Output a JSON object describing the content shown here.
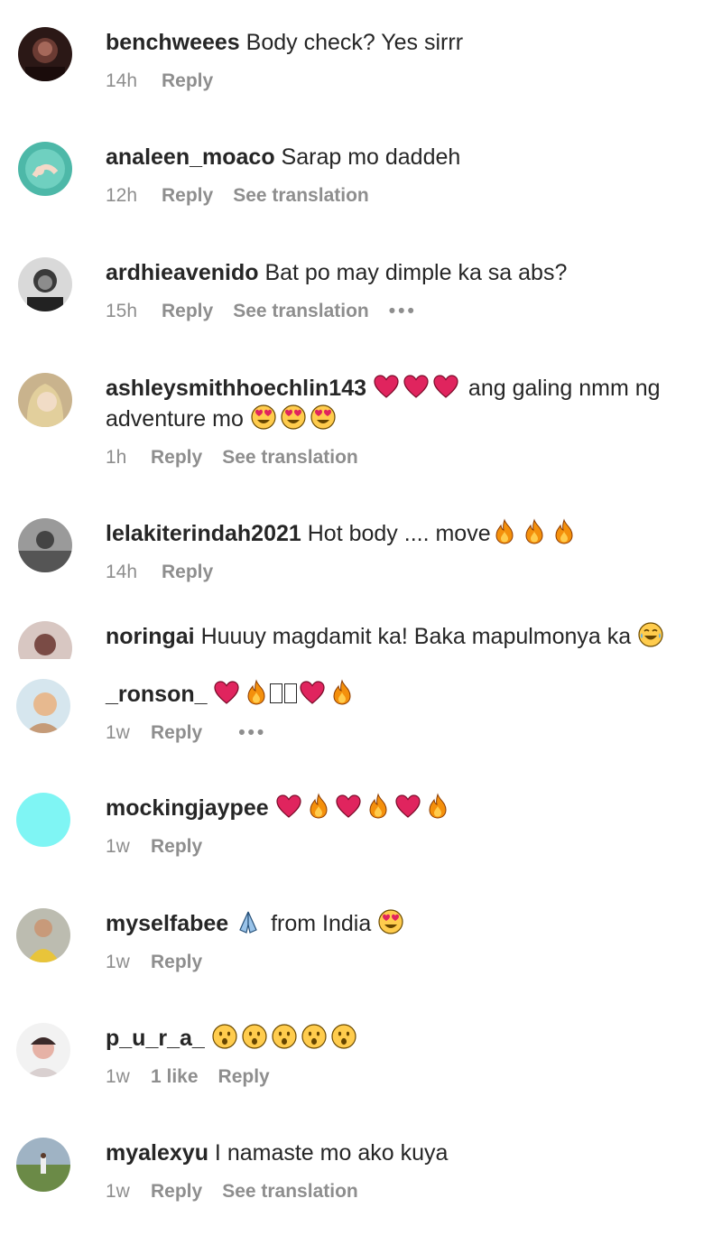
{
  "comments": [
    {
      "username": "benchweees",
      "text": "Body check? Yes sirrr",
      "time": "14h",
      "reply": "Reply"
    },
    {
      "username": "analeen_moaco",
      "text": "Sarap mo daddeh",
      "time": "12h",
      "reply": "Reply",
      "see_translation": "See translation"
    },
    {
      "username": "ardhieavenido",
      "text": "Bat po may dimple ka sa abs?",
      "time": "15h",
      "reply": "Reply",
      "see_translation": "See translation",
      "more": "•••"
    },
    {
      "username": "ashleysmithhoechlin143",
      "text": "ang galing nmm ng",
      "text2": "adventure mo",
      "time": "1h",
      "reply": "Reply",
      "see_translation": "See translation"
    },
    {
      "username": "lelakiterindah2021",
      "text": "Hot body .... move",
      "time": "14h",
      "reply": "Reply"
    },
    {
      "username": "noringai",
      "text": "Huuuy magdamit ka! Baka mapulmonya ka"
    },
    {
      "username": "_ronson_",
      "time": "1w",
      "reply": "Reply",
      "more": "•••"
    },
    {
      "username": "mockingjaypee",
      "time": "1w",
      "reply": "Reply"
    },
    {
      "username": "myselfabee",
      "text": "from India",
      "time": "1w",
      "reply": "Reply"
    },
    {
      "username": "p_u_r_a_",
      "time": "1w",
      "likes": "1 like",
      "reply": "Reply"
    },
    {
      "username": "myalexyu",
      "text": "I namaste mo ako kuya",
      "time": "1w",
      "reply": "Reply",
      "see_translation": "See translation"
    }
  ],
  "colors": {
    "text": "#262626",
    "meta": "#8e8e8e",
    "heart": "#e0245e",
    "fire": "#f4900c",
    "face": "#ffcc4d"
  }
}
